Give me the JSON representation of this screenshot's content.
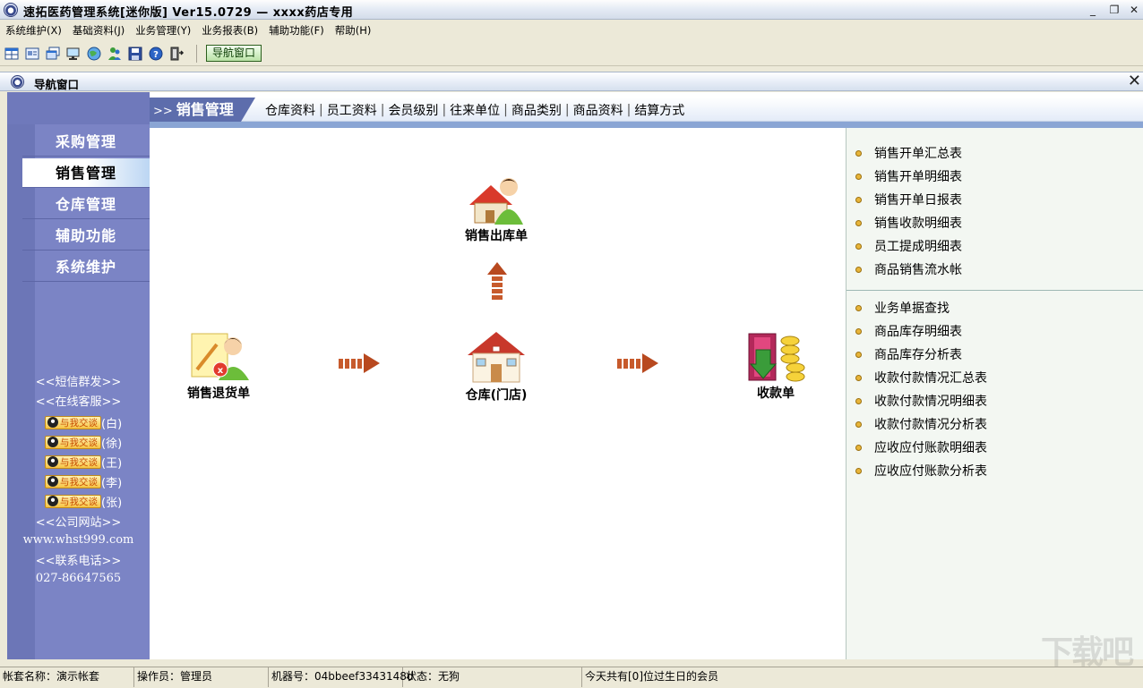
{
  "window": {
    "title": "速拓医药管理系统[迷你版] Ver15.0729 — xxxx药店专用",
    "minimize_glyph": "_",
    "restore_glyph": "❐",
    "close_glyph": "✕"
  },
  "menu": [
    "系统维护(X)",
    "基础资料(J)",
    "业务管理(Y)",
    "业务报表(B)",
    "辅助功能(F)",
    "帮助(H)"
  ],
  "toolbar": {
    "icons": [
      "grid-icon",
      "card-icon",
      "windows-icon",
      "monitor-icon",
      "globe-icon",
      "users-icon",
      "save-icon",
      "help-icon",
      "exit-icon"
    ],
    "nav_button": "导航窗口"
  },
  "nav_window": {
    "title": "导航窗口",
    "close_glyph": "✕"
  },
  "sidebar": {
    "items": [
      {
        "label": "采购管理",
        "active": false
      },
      {
        "label": "销售管理",
        "active": true
      },
      {
        "label": "仓库管理",
        "active": false
      },
      {
        "label": "辅助功能",
        "active": false
      },
      {
        "label": "系统维护",
        "active": false
      }
    ],
    "sms": "<<短信群发>>",
    "online": "<<在线客服>>",
    "qq_badge": "与我交谈",
    "qq_names": [
      "(白)",
      "(徐)",
      "(王)",
      "(李)",
      "(张)"
    ],
    "site_label": "<<公司网站>>",
    "site_url": "www.whst999.com",
    "phone_label": "<<联系电话>>",
    "phone": "027-86647565"
  },
  "tabs": {
    "active_prefix": ">>",
    "active": "销售管理",
    "links": [
      "仓库资料",
      "员工资料",
      "会员级别",
      "往来单位",
      "商品类别",
      "商品资料",
      "结算方式"
    ]
  },
  "diagram": {
    "sale_out": "销售出库单",
    "sale_return": "销售退货单",
    "warehouse": "仓库(门店)",
    "receipt": "收款单"
  },
  "reports": {
    "group1": [
      "销售开单汇总表",
      "销售开单明细表",
      "销售开单日报表",
      "销售收款明细表",
      "员工提成明细表",
      "商品销售流水帐"
    ],
    "group2": [
      "业务单据查找",
      "商品库存明细表",
      "商品库存分析表",
      "收款付款情况汇总表",
      "收款付款情况明细表",
      "收款付款情况分析表",
      "应收应付账款明细表",
      "应收应付账款分析表"
    ]
  },
  "status": {
    "account": "帐套名称：演示帐套",
    "operator": "操作员：管理员",
    "machine": "机器号：04bbeef3343148d",
    "state": "状态：无狗",
    "birthday": "今天共有[0]位过生日的会员"
  },
  "watermark": "下载吧"
}
